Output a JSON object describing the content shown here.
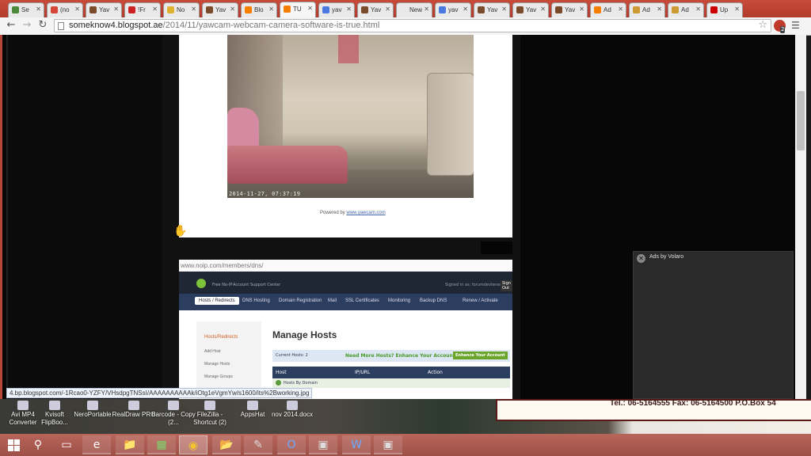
{
  "tabs": [
    {
      "title": "Se",
      "favicon_color": "#4a8a3a"
    },
    {
      "title": "(no",
      "favicon_color": "#d44638"
    },
    {
      "title": "Yav",
      "favicon_color": "#7a4a2a"
    },
    {
      "title": "!Fr",
      "favicon_color": "#cc2222"
    },
    {
      "title": "No",
      "favicon_color": "#e0b030"
    },
    {
      "title": "Yav",
      "favicon_color": "#7a4a2a"
    },
    {
      "title": "Blo",
      "favicon_color": "#f57d00"
    },
    {
      "title": "TU",
      "favicon_color": "#f57d00",
      "active": true
    },
    {
      "title": "yav",
      "favicon_color": "#4a7ae0"
    },
    {
      "title": "Yav",
      "favicon_color": "#7a4a2a"
    },
    {
      "title": "New T",
      "favicon_color": "#e9e9e9"
    },
    {
      "title": "yav",
      "favicon_color": "#4a7ae0"
    },
    {
      "title": "Yav",
      "favicon_color": "#7a4a2a"
    },
    {
      "title": "Yav",
      "favicon_color": "#7a4a2a"
    },
    {
      "title": "Yav",
      "favicon_color": "#7a4a2a"
    },
    {
      "title": "Ad",
      "favicon_color": "#f57d00"
    },
    {
      "title": "Ad",
      "favicon_color": "#cc9933"
    },
    {
      "title": "Ad",
      "favicon_color": "#cc9933"
    },
    {
      "title": "Up",
      "favicon_color": "#cc0000"
    }
  ],
  "toolbar": {
    "url_host": "someknow4.blogspot.ae",
    "url_path": "/2014/11/yawcam-webcam-camera-software-is-true.html",
    "extension_count": "2"
  },
  "page": {
    "camera_timestamp": "2014-11-27, 07:37:19",
    "powered_by": "Powered by",
    "powered_link": "www.yawcam.com",
    "embedded_url": "www.noip.com/members/dns/",
    "status_url": "4.bp.blogspot.com/-1Rcao0-YZFY/VHsdpgTNSsI/AAAAAAAAAAk/iOtg1eVgmYw/s1600/its%2Bworking.jpg"
  },
  "noip": {
    "top_links": [
      "Free No-IP",
      "Account",
      "Support Center"
    ],
    "signin": "Signed in as: forumdevtenerai2",
    "sign_out": "Sign Out",
    "nav": [
      "Hosts / Redirects",
      "DNS Hosting",
      "Domain Registration",
      "Mail",
      "SSL Certificates",
      "Monitoring",
      "Backup DNS",
      "Renew / Activate"
    ],
    "side_heading": "Hosts/Redirects",
    "side_items": [
      "Add Host",
      "Manage Hosts",
      "Manage Groups"
    ],
    "title": "Manage Hosts",
    "current_hosts": "Current Hosts: 2",
    "need_more": "Need More Hosts? Enhance Your Account!",
    "enhance_button": "Enhance Your Account",
    "columns": [
      "Host",
      "IP/URL",
      "Action"
    ],
    "row_label": "Hosts By Domain"
  },
  "ad_panel": {
    "label": "Ads by Volaro"
  },
  "desktop": {
    "icons": [
      "Avi MP4 Converter",
      "Kvisoft FlipBoo...",
      "NeroPortable",
      "RealDraw PRO",
      "Barcode - Copy (2...",
      "FileZilla - Shortcut (2)",
      "AppsHat",
      "nov 2014.docx"
    ],
    "banner": "Tel.: 06-5164555   Fax: 06-5164500   P.O.Box 54"
  },
  "taskbar": {
    "apps": [
      "search",
      "task-view",
      "internet-explorer",
      "file-explorer",
      "store",
      "chrome",
      "folder",
      "paint",
      "outlook",
      "camera",
      "word",
      "camera-2"
    ]
  }
}
